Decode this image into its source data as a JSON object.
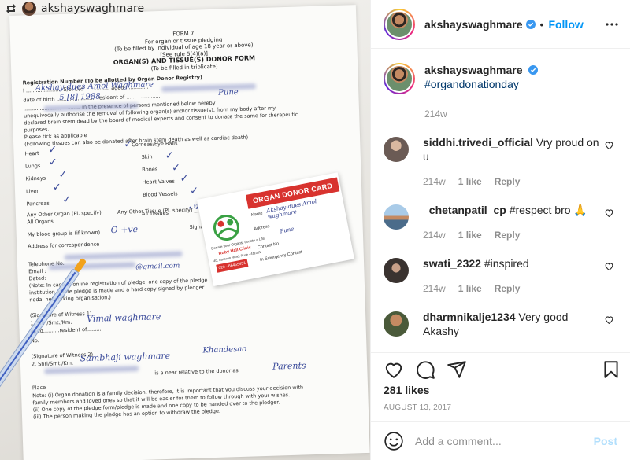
{
  "repost": {
    "username": "akshayswaghmare",
    "icon": "repost-icon"
  },
  "photo": {
    "form": {
      "heading_lines": [
        "FORM 7",
        "For organ or tissue pledging",
        "(To be filled by individual of age 18 year or above)",
        "[See rule 5(4)(a)]",
        "ORGAN(S) AND TISSUE(S) DONOR FORM",
        "(To be filled in triplicate)"
      ],
      "registration_label": "Registration Number (To be allotted by Organ Donor Registry)",
      "rows": [
        "I ...................... S/o, D/o ............... aged ..............",
        "date of birth ........................ resident of .....................",
        "................................... in the presence of persons mentioned below hereby",
        "unequivocally authorise the removal of following organ(s) and/or tissue(s), from my body after my",
        "declared brain stem dead by the board of medical experts and consent to donate the same for therapeutic",
        "purposes.",
        "Please tick as applicable",
        "(Following tissues can also be donated after brain stem death as well as cardiac death)"
      ],
      "organs": [
        "Heart",
        "Lungs",
        "Kidneys",
        "Liver",
        "Pancreas"
      ],
      "tissues": [
        "Corneas/Eye Balls",
        "Skin",
        "Bones",
        "Heart Valves",
        "Blood Vessels"
      ],
      "other_organ": "Any Other Organ (Pl. specify) _____ Any Other Tissue (Pl. specify) ____",
      "all_organs": "All Organs",
      "all_tissues": "All Tissues",
      "blood_group": "My blood group is (if known)",
      "signature": "Signature of Pledger",
      "address": "Address for correspondence",
      "telephone": "Telephone No.",
      "email": "Email :",
      "dated": "Dated:",
      "note_lines": [
        "(Note: In case of online registration of pledge, one copy of the pledge",
        "institution where pledge is made and a hard copy signed by pledger",
        "nodal networking organisation.)"
      ],
      "witness1": "(Signature of Witness 1)",
      "witness1_line": "1. Shri/Smt./Km.",
      "witness2": "(Signature of Witness 2)",
      "witness2_line": "2. Shri/Smt./Km.",
      "aged": "aged..........resident of..........",
      "no": "No.",
      "relative_line": "is a near relative to the donor as",
      "place": "Place",
      "final_notes": [
        "Note: (i) Organ donation is a family decision, therefore, it is important that you discuss your decision with",
        "family members and loved ones so that it will be easier for them to follow through with your wishes.",
        "(ii) One copy of the pledge form/pledge is made and one copy to be handed over to the pledger.",
        "(iii) The person making the pledge has an option to withdraw the pledge."
      ],
      "handwriting": {
        "name": "Akshay dues Amol Waghmare",
        "dob": "5 [8] 1988",
        "city": "Pune",
        "blood": "O +ve",
        "email_tail": "@gmail.com",
        "witness1": "Vimal waghmare",
        "witness2": "Sambhaji waghmare",
        "witness2_place": "Khandesao",
        "relation": "Parents"
      }
    },
    "card": {
      "title": "ORGAN DONOR CARD",
      "name_label": "Name",
      "address_label": "Address",
      "contact_label": "Contact No",
      "emergency_label": "In Emergency Contact",
      "name_value": "Akshay dues Amol waghmare",
      "address_value": "Pune",
      "logo_caption": "Donate your Organs, donate a Life",
      "clinic": "Ruby Hall Clinic",
      "clinic_address": "40, Sassoon Road, Pune - 411001",
      "phone": "020 - 66455451"
    }
  },
  "header": {
    "username": "akshayswaghmare",
    "separator": "•",
    "follow_label": "Follow",
    "verified_icon": "verified-badge-icon",
    "more_icon": "more-horizontal-icon"
  },
  "caption": {
    "username": "akshayswaghmare",
    "hashtag": "#organdonationday",
    "time": "214w"
  },
  "comments": [
    {
      "username": "siddhi.trivedi_official",
      "text": "Vry proud on u",
      "time": "214w",
      "likes": "1 like",
      "reply": "Reply",
      "avatar_color": "#6b5b55"
    },
    {
      "username": "_chetanpatil_cp",
      "text": "#respect bro 🙏",
      "time": "214w",
      "likes": "1 like",
      "reply": "Reply",
      "avatar_color": "#7fa7c9"
    },
    {
      "username": "swati_2322",
      "text": "#inspired",
      "time": "214w",
      "likes": "1 like",
      "reply": "Reply",
      "avatar_color": "#3a3330"
    },
    {
      "username": "dharmnikalje1234",
      "text": "Very good Akashy",
      "time": "",
      "likes": "",
      "reply": "",
      "avatar_color": "#8a6a4a"
    }
  ],
  "actions": {
    "like_icon": "heart-icon",
    "comment_icon": "comment-icon",
    "share_icon": "share-icon",
    "save_icon": "bookmark-icon"
  },
  "likes": "281 likes",
  "date": "AUGUST 13, 2017",
  "add_comment": {
    "emoji_icon": "emoji-icon",
    "placeholder": "Add a comment...",
    "post_label": "Post"
  },
  "colors": {
    "link_blue": "#0095f6",
    "hashtag_blue": "#00376b",
    "muted": "#8e8e8e",
    "card_red": "#d8332f",
    "post_disabled": "#b2dffc"
  }
}
